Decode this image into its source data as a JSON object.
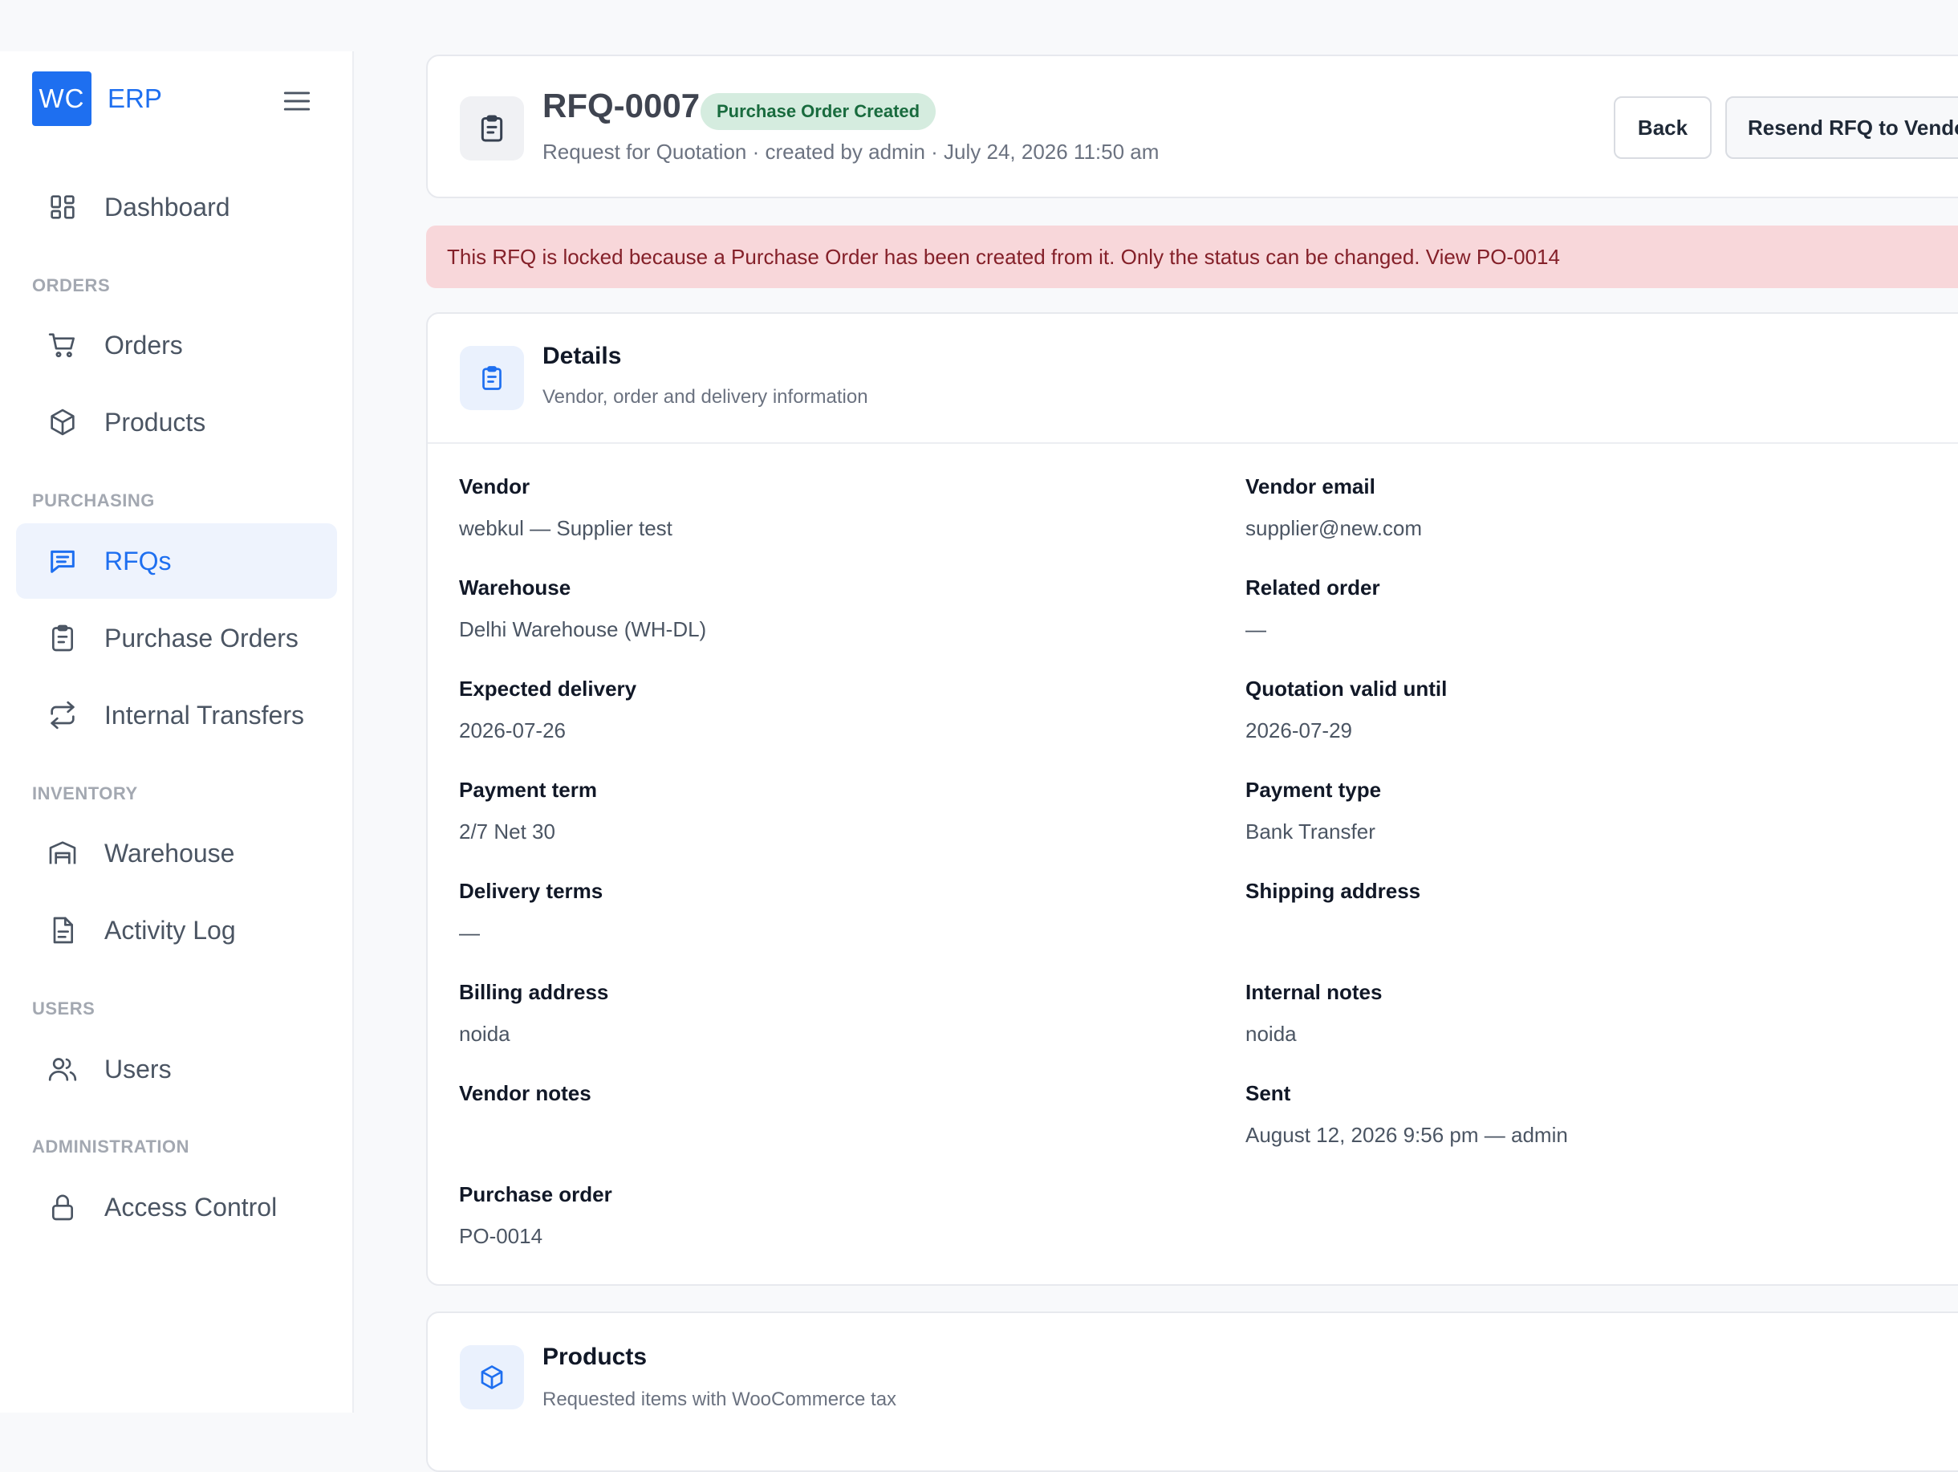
{
  "brand": {
    "logo": "WC",
    "name": "ERP"
  },
  "sidebar": {
    "dashboard": "Dashboard",
    "sections": {
      "orders": "ORDERS",
      "purchasing": "PURCHASING",
      "inventory": "INVENTORY",
      "users": "USERS",
      "administration": "ADMINISTRATION"
    },
    "items": {
      "orders": "Orders",
      "products": "Products",
      "rfqs": "RFQs",
      "purchase_orders": "Purchase Orders",
      "internal_transfers": "Internal Transfers",
      "warehouse": "Warehouse",
      "activity_log": "Activity Log",
      "users": "Users",
      "access_control": "Access Control"
    },
    "active": "RFQs"
  },
  "header": {
    "title": "RFQ-0007",
    "status": "Purchase Order Created",
    "subtitle": "Request for Quotation · created by admin · July 24, 2026 11:50 am",
    "back_label": "Back",
    "resend_label": "Resend RFQ to Vendor"
  },
  "alert": {
    "message": "This RFQ is locked because a Purchase Order has been created from it. Only the status can be changed. View PO-0014"
  },
  "details": {
    "title": "Details",
    "subtitle": "Vendor, order and delivery information",
    "fields": {
      "vendor": {
        "label": "Vendor",
        "value": "webkul — Supplier test"
      },
      "vendor_email": {
        "label": "Vendor email",
        "value": "supplier@new.com"
      },
      "warehouse": {
        "label": "Warehouse",
        "value": "Delhi Warehouse (WH-DL)"
      },
      "related_order": {
        "label": "Related order",
        "value": "—"
      },
      "expected_delivery": {
        "label": "Expected delivery",
        "value": "2026-07-26"
      },
      "quotation_valid_until": {
        "label": "Quotation valid until",
        "value": "2026-07-29"
      },
      "payment_term": {
        "label": "Payment term",
        "value": "2/7 Net 30"
      },
      "payment_type": {
        "label": "Payment type",
        "value": "Bank Transfer"
      },
      "delivery_terms": {
        "label": "Delivery terms",
        "value": "—"
      },
      "shipping_address": {
        "label": "Shipping address",
        "value": ""
      },
      "billing_address": {
        "label": "Billing address",
        "value": "noida"
      },
      "internal_notes": {
        "label": "Internal notes",
        "value": "noida"
      },
      "vendor_notes": {
        "label": "Vendor notes",
        "value": ""
      },
      "sent": {
        "label": "Sent",
        "value": "August 12, 2026 9:56 pm — admin"
      },
      "purchase_order": {
        "label": "Purchase order",
        "value": "PO-0014"
      }
    }
  },
  "products": {
    "title": "Products",
    "subtitle": "Requested items with WooCommerce tax"
  },
  "colors": {
    "accent": "#1e6ff0",
    "badge_bg": "#d5ecdf",
    "badge_text": "#196b3e",
    "alert_bg": "#f8d7da",
    "alert_text": "#842029"
  }
}
